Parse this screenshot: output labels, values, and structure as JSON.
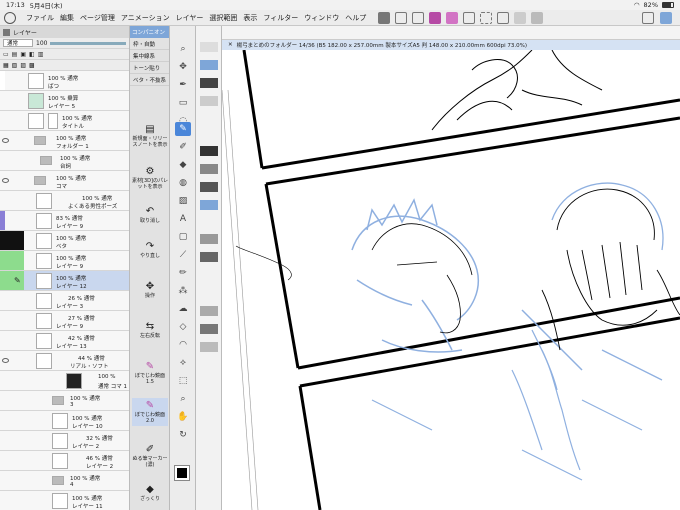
{
  "status_bar": {
    "time": "17:13",
    "date": "5月4日(木)",
    "battery": "82%"
  },
  "menu": [
    "ファイル",
    "編集",
    "ページ管理",
    "アニメーション",
    "レイヤー",
    "選択範囲",
    "表示",
    "フィルター",
    "ウィンドウ",
    "ヘルプ"
  ],
  "layer_panel": {
    "tab_label": "レイヤー",
    "blend_mode": "通常",
    "opacity": "100",
    "layers": [
      {
        "pct": "100 %",
        "mode": "通常",
        "name": "ばつ"
      },
      {
        "pct": "100 %",
        "mode": "乗算",
        "name": "レイヤー 5"
      },
      {
        "pct": "100 %",
        "mode": "通常",
        "name": "タイトル"
      },
      {
        "pct": "100 %",
        "mode": "通常",
        "name": "フォルダー 1"
      },
      {
        "pct": "100 %",
        "mode": "通常",
        "name": "台詞"
      },
      {
        "pct": "100 %",
        "mode": "通常",
        "name": "コマ"
      },
      {
        "pct": "100 %",
        "mode": "通常",
        "name": "よくある男性ポーズ"
      },
      {
        "pct": "83 %",
        "mode": "通常",
        "name": "レイヤー 9"
      },
      {
        "pct": "100 %",
        "mode": "通常",
        "name": "ベタ"
      },
      {
        "pct": "100 %",
        "mode": "通常",
        "name": "レイヤー 9"
      },
      {
        "pct": "100 %",
        "mode": "通常",
        "name": "レイヤー 12"
      },
      {
        "pct": "26 %",
        "mode": "通常",
        "name": "レイヤー 3"
      },
      {
        "pct": "27 %",
        "mode": "通常",
        "name": "レイヤー 9"
      },
      {
        "pct": "42 %",
        "mode": "通常",
        "name": "レイヤー 13"
      },
      {
        "pct": "44 %",
        "mode": "通常",
        "name": "リアル・ソフト"
      },
      {
        "pct": "100 %",
        "mode": "通常",
        "name": "コマ 1"
      },
      {
        "pct": "100 %",
        "mode": "通常",
        "name": "3"
      },
      {
        "pct": "100 %",
        "mode": "通常",
        "name": "レイヤー 10"
      },
      {
        "pct": "32 %",
        "mode": "通常",
        "name": "レイヤー 2"
      },
      {
        "pct": "46 %",
        "mode": "通常",
        "name": "レイヤー 2"
      },
      {
        "pct": "100 %",
        "mode": "通常",
        "name": "4"
      },
      {
        "pct": "100 %",
        "mode": "通常",
        "name": "レイヤー 11"
      }
    ]
  },
  "mid_panel": {
    "tab": "コンパニオン",
    "buttons": [
      "枠・自動",
      "集中線系",
      "トーン貼り",
      "ベタ・不抜系"
    ],
    "commands": [
      "新規面・リリースノートを表示",
      "素材[3D]のパレットを表示",
      "取り消し",
      "やり直し",
      "操作",
      "左右反転",
      "ぼでじわ鏡面1.5",
      "ぼでじわ鏡面2.0",
      "ぬる筆マーカー(濃)",
      "ざっくり"
    ]
  },
  "canvas": {
    "title": "楊弓まとめのフォルダー 14/36 (B5 182.00 x 257.00mm 製本サイズA5 判 148.00 x 210.00mm 600dpi 73.0%)"
  },
  "colors": {
    "accent": "#4a86d9",
    "sketch": "#8fb0e0"
  }
}
